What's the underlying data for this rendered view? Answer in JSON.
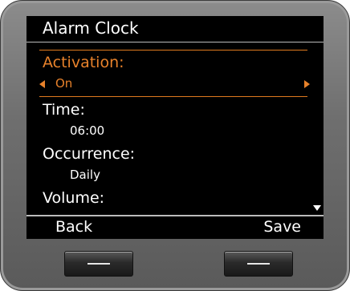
{
  "screen": {
    "title": "Alarm Clock",
    "activation": {
      "label": "Activation:",
      "value": "On"
    },
    "time": {
      "label": "Time:",
      "value": "06:00"
    },
    "occurrence": {
      "label": "Occurrence:",
      "value": "Daily"
    },
    "volume": {
      "label": "Volume:"
    }
  },
  "softkeys": {
    "left": "Back",
    "right": "Save"
  },
  "colors": {
    "accent": "#e8822b",
    "background": "#000000",
    "text": "#ffffff"
  },
  "icons": [
    "left-arrow-icon",
    "right-arrow-icon",
    "scroll-down-icon"
  ]
}
